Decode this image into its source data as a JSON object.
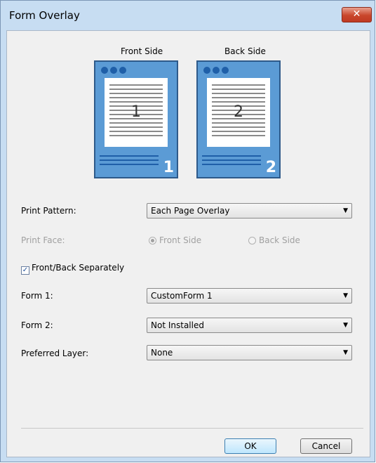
{
  "window": {
    "title": "Form Overlay",
    "close_glyph": "✕"
  },
  "preview": {
    "front_label": "Front Side",
    "back_label": "Back Side",
    "front_number": "1",
    "back_number": "2"
  },
  "print_pattern": {
    "label": "Print Pattern:",
    "value": "Each Page Overlay"
  },
  "print_face": {
    "label": "Print Face:",
    "options": [
      "Front Side",
      "Back Side"
    ],
    "selected": "Front Side",
    "enabled": false
  },
  "front_back_separately": {
    "label": "Front/Back Separately",
    "checked": true
  },
  "form1": {
    "label": "Form 1:",
    "value": "CustomForm 1"
  },
  "form2": {
    "label": "Form 2:",
    "value": "Not Installed"
  },
  "preferred_layer": {
    "label": "Preferred Layer:",
    "value": "None"
  },
  "buttons": {
    "ok": "OK",
    "cancel": "Cancel"
  },
  "icons": {
    "dropdown": "chevron-down-icon",
    "check": "checkmark-icon",
    "close": "close-icon"
  },
  "colors": {
    "page_blue": "#5b9bd5",
    "dark_blue": "#1f5fa8",
    "frame": "#c7ddf2"
  }
}
